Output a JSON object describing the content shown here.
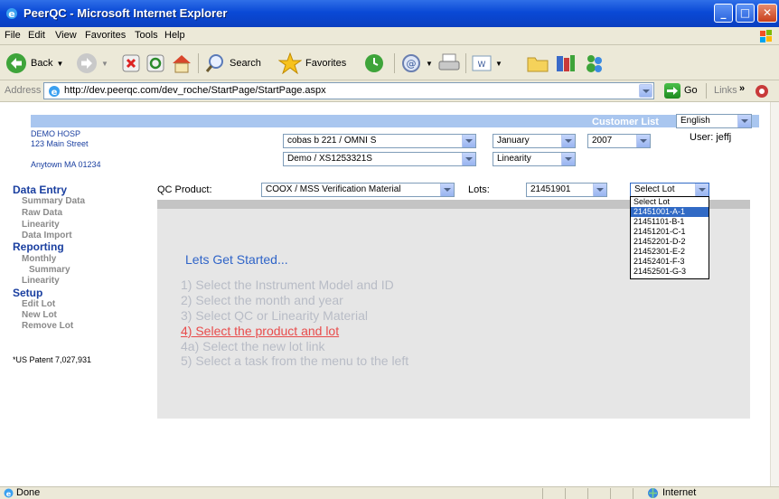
{
  "window": {
    "title": "PeerQC - Microsoft Internet Explorer"
  },
  "menu": [
    "File",
    "Edit",
    "View",
    "Favorites",
    "Tools",
    "Help"
  ],
  "toolbar": {
    "back_label": "Back",
    "search_label": "Search",
    "favorites_label": "Favorites"
  },
  "address": {
    "label": "Address",
    "url": "http://dev.peerqc.com/dev_roche/StartPage/StartPage.aspx",
    "go_label": "Go",
    "links_label": "Links"
  },
  "header": {
    "customer_list": "Customer List",
    "language": "English",
    "user": "User: jeffj",
    "hospital_name": "DEMO HOSP",
    "street": "123 Main Street",
    "city": "Anytown MA 01234",
    "instrument_model": "cobas b 221 / OMNI S",
    "instrument_id": "Demo / XS1253321S",
    "month": "January",
    "year": "2007",
    "material_type": "Linearity"
  },
  "qc": {
    "product_label": "QC Product:",
    "product_value": "COOX / MSS Verification Material",
    "lots_label": "Lots:",
    "lots_value": "21451901",
    "select_lot_value": "Select Lot"
  },
  "lot_options": [
    "Select Lot",
    "21451001-A-1",
    "21451101-B-1",
    "21451201-C-1",
    "21452201-D-2",
    "21452301-E-2",
    "21452401-F-3",
    "21452501-G-3"
  ],
  "sidebar": {
    "data_entry": "Data Entry",
    "summary_data": "Summary Data",
    "raw_data": "Raw Data",
    "linearity": "Linearity",
    "data_import": "Data Import",
    "reporting": "Reporting",
    "monthly": "Monthly",
    "summary": "Summary",
    "linearity2": "Linearity",
    "setup": "Setup",
    "edit_lot": "Edit Lot",
    "new_lot": "New Lot",
    "remove_lot": "Remove Lot",
    "patent": "*US Patent 7,027,931"
  },
  "main": {
    "heading": "Lets Get Started...",
    "steps": [
      "1) Select the Instrument Model and ID",
      "2) Select the month and year",
      "3) Select QC or Linearity Material",
      "4) Select the product and lot",
      "4a) Select the new lot link",
      "5) Select a task from the menu to the left"
    ]
  },
  "status": {
    "left": "Done",
    "zone": "Internet"
  },
  "colors": {
    "header_band": "#a9c6ef",
    "panel": "#e6e6e6",
    "nav_heading": "#1a3fa0",
    "step_highlight": "#e84c4c",
    "step_muted": "#b8bcc6",
    "heading_blue": "#2f64c8"
  }
}
